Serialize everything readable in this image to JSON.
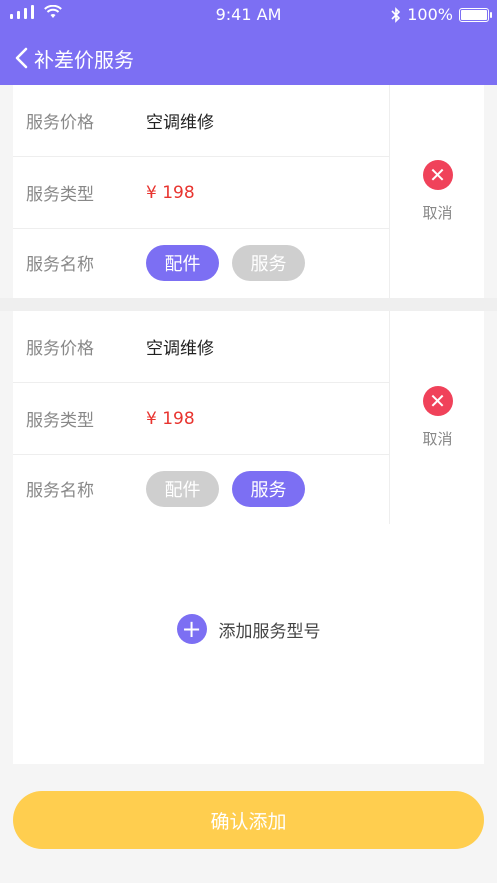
{
  "status": {
    "time": "9:41 AM",
    "battery_text": "100%"
  },
  "nav": {
    "title": "补差价服务"
  },
  "cards": [
    {
      "rows": [
        {
          "label": "服务价格",
          "value": "空调维修"
        },
        {
          "label": "服务类型",
          "value": "¥ 198"
        },
        {
          "label": "服务名称"
        }
      ],
      "pills": [
        {
          "label": "配件",
          "selected": true
        },
        {
          "label": "服务",
          "selected": false
        }
      ],
      "cancel_label": "取消"
    },
    {
      "rows": [
        {
          "label": "服务价格",
          "value": "空调维修"
        },
        {
          "label": "服务类型",
          "value": "¥ 198"
        },
        {
          "label": "服务名称"
        }
      ],
      "pills": [
        {
          "label": "配件",
          "selected": false
        },
        {
          "label": "服务",
          "selected": true
        }
      ],
      "cancel_label": "取消"
    }
  ],
  "add": {
    "label": "添加服务型号"
  },
  "confirm": {
    "label": "确认添加"
  },
  "colors": {
    "primary": "#7c6ff3",
    "price": "#e8342f",
    "cancel": "#f0425a",
    "confirm": "#ffce4f",
    "pill_inactive": "#cfcfcf"
  }
}
